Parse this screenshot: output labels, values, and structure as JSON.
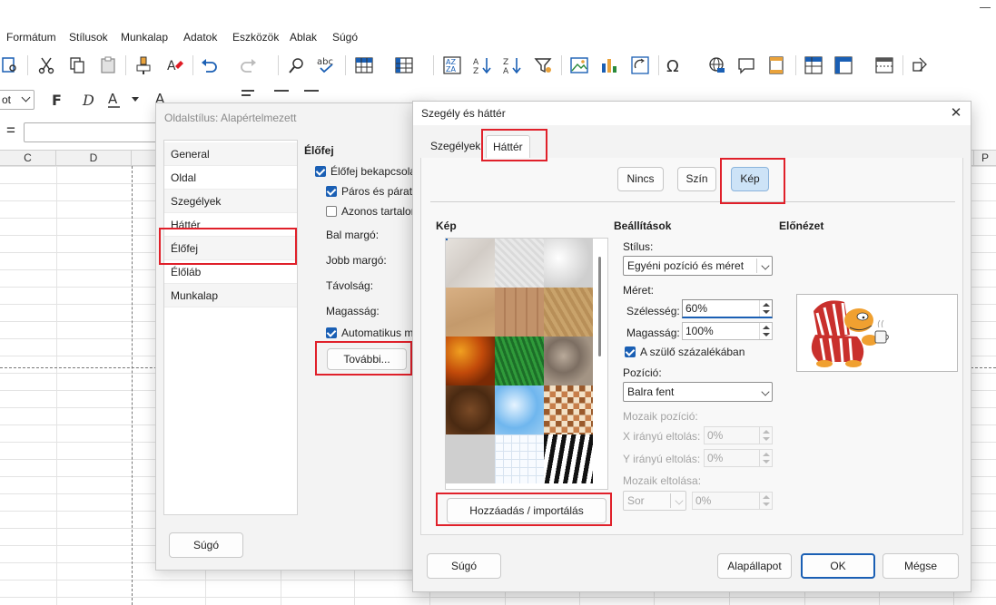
{
  "menubar": {
    "items": [
      "Formátum",
      "Stílusok",
      "Munkalap",
      "Adatok",
      "Eszközök",
      "Ablak",
      "Súgó"
    ]
  },
  "toolbar2": {
    "font_size_fragment": "ot"
  },
  "formula": {
    "equals": "="
  },
  "columns": [
    "C",
    "D",
    "P"
  ],
  "page_style_dialog": {
    "title": "Oldalstílus: Alapértelmezett",
    "nav": [
      "General",
      "Oldal",
      "Szegélyek",
      "Háttér",
      "Élőfej",
      "Élőláb",
      "Munkalap"
    ],
    "section": "Élőfej",
    "header_on": "Élőfej bekapcsolá",
    "same_lr": "Páros és páratla",
    "same_content": "Azonos tartalor",
    "left_margin": "Bal margó:",
    "right_margin": "Jobb margó:",
    "spacing": "Távolság:",
    "height": "Magasság:",
    "auto_height": "Automatikus m",
    "more_button": "További...",
    "help_button": "Súgó"
  },
  "bg_dialog": {
    "title": "Szegély és háttér",
    "tabs": [
      "Szegélyek",
      "Háttér"
    ],
    "modes": [
      "Nincs",
      "Szín",
      "Kép"
    ],
    "image_section": "Kép",
    "settings_section": "Beállítások",
    "preview_section": "Előnézet",
    "style_label": "Stílus:",
    "style_value": "Egyéni pozíció és méret",
    "size_label": "Méret:",
    "width_label": "Szélesség:",
    "width_value": "60%",
    "height_label": "Magasság:",
    "height_value": "100%",
    "parent_percent": "A szülő százalékában",
    "position_label": "Pozíció:",
    "position_value": "Balra fent",
    "tile_position_label": "Mozaik pozíció:",
    "x_offset_label": "X irányú eltolás:",
    "x_offset_value": "0%",
    "y_offset_label": "Y irányú eltolás:",
    "y_offset_value": "0%",
    "tile_offset_label": "Mozaik eltolása:",
    "tile_offset_mode": "Sor",
    "tile_offset_value": "0%",
    "add_import": "Hozzáadás / importálás",
    "help": "Súgó",
    "reset": "Alapállapot",
    "ok": "OK",
    "cancel": "Mégse"
  },
  "colors": {
    "highlight_red": "#e0202a",
    "checkbox_blue": "#1a5fb4",
    "selected_button": "#cde3f7"
  }
}
